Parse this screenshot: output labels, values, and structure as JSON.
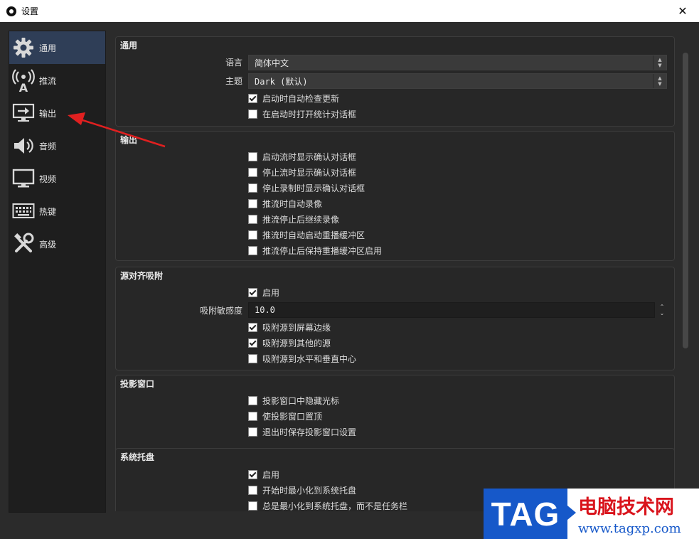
{
  "window": {
    "title": "设置",
    "close_glyph": "✕"
  },
  "sidebar": {
    "items": [
      {
        "label": "通用",
        "icon": "gear-icon",
        "active": true
      },
      {
        "label": "推流",
        "icon": "broadcast-icon",
        "active": false
      },
      {
        "label": "输出",
        "icon": "output-icon",
        "active": false
      },
      {
        "label": "音频",
        "icon": "speaker-icon",
        "active": false
      },
      {
        "label": "视频",
        "icon": "monitor-icon",
        "active": false
      },
      {
        "label": "热键",
        "icon": "keyboard-icon",
        "active": false
      },
      {
        "label": "高级",
        "icon": "tools-icon",
        "active": false
      }
    ]
  },
  "general": {
    "title": "通用",
    "language_label": "语言",
    "language_value": "简体中文",
    "theme_label": "主题",
    "theme_value": "Dark (默认)",
    "check_updates": "启动时自动检查更新",
    "open_stats": "在启动时打开统计对话框"
  },
  "output": {
    "title": "输出",
    "options": [
      {
        "label": "启动流时显示确认对话框",
        "checked": false
      },
      {
        "label": "停止流时显示确认对话框",
        "checked": false
      },
      {
        "label": "停止录制时显示确认对话框",
        "checked": false
      },
      {
        "label": "推流时自动录像",
        "checked": false
      },
      {
        "label": "推流停止后继续录像",
        "checked": false
      },
      {
        "label": "推流时自动启动重播缓冲区",
        "checked": false
      },
      {
        "label": "推流停止后保持重播缓冲区启用",
        "checked": false
      }
    ]
  },
  "snapping": {
    "title": "源对齐吸附",
    "enable": "启用",
    "sensitivity_label": "吸附敏感度",
    "sensitivity_value": "10.0",
    "snap_edges": "吸附源到屏幕边缘",
    "snap_other": "吸附源到其他的源",
    "snap_center": "吸附源到水平和垂直中心"
  },
  "projector": {
    "title": "投影窗口",
    "hide_cursor": "投影窗口中隐藏光标",
    "always_top": "使投影窗口置顶",
    "save_on_exit": "退出时保存投影窗口设置"
  },
  "tray": {
    "title": "系统托盘",
    "enable": "启用",
    "minimize_start": "开始时最小化到系统托盘",
    "always_minimize": "总是最小化到系统托盘，而不是任务栏"
  },
  "watermark": {
    "tag": "TAG",
    "title": "电脑技术网",
    "url": "www.tagxp.com"
  },
  "colors": {
    "accent_arrow": "#e02020",
    "active_item": "#2f3e57",
    "watermark_blue": "#1658c9",
    "watermark_red": "#d9141c"
  }
}
